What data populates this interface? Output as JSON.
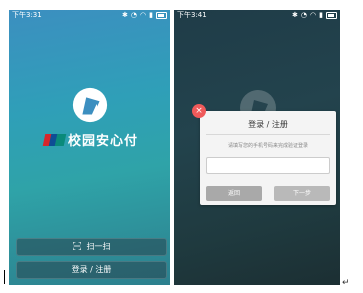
{
  "left": {
    "status_time": "下午3:31",
    "status_icons": [
      "bluetooth-icon",
      "alarm-icon",
      "wifi-icon",
      "signal-icon",
      "battery-icon"
    ],
    "app_name": "校园安心付",
    "scan_label": "扫一扫",
    "login_label": "登录 / 注册"
  },
  "right": {
    "status_time": "下午3:41",
    "dialog": {
      "title": "登录 / 注册",
      "hint": "请填写您的手机号码来完成验证登录",
      "input_value": "",
      "return_label": "返回",
      "next_label": "下一步",
      "close_symbol": "×"
    }
  },
  "colors": {
    "left_bg_top": "#3c8fc0",
    "left_bg_bottom": "#2c7f8d",
    "right_bg": "#23434d",
    "close_red": "#ef5a5a",
    "unionpay_red": "#d7262c",
    "unionpay_blue": "#0e4d95",
    "unionpay_teal": "#0a8a7a"
  },
  "markers": {
    "return_glyph": "↵"
  }
}
